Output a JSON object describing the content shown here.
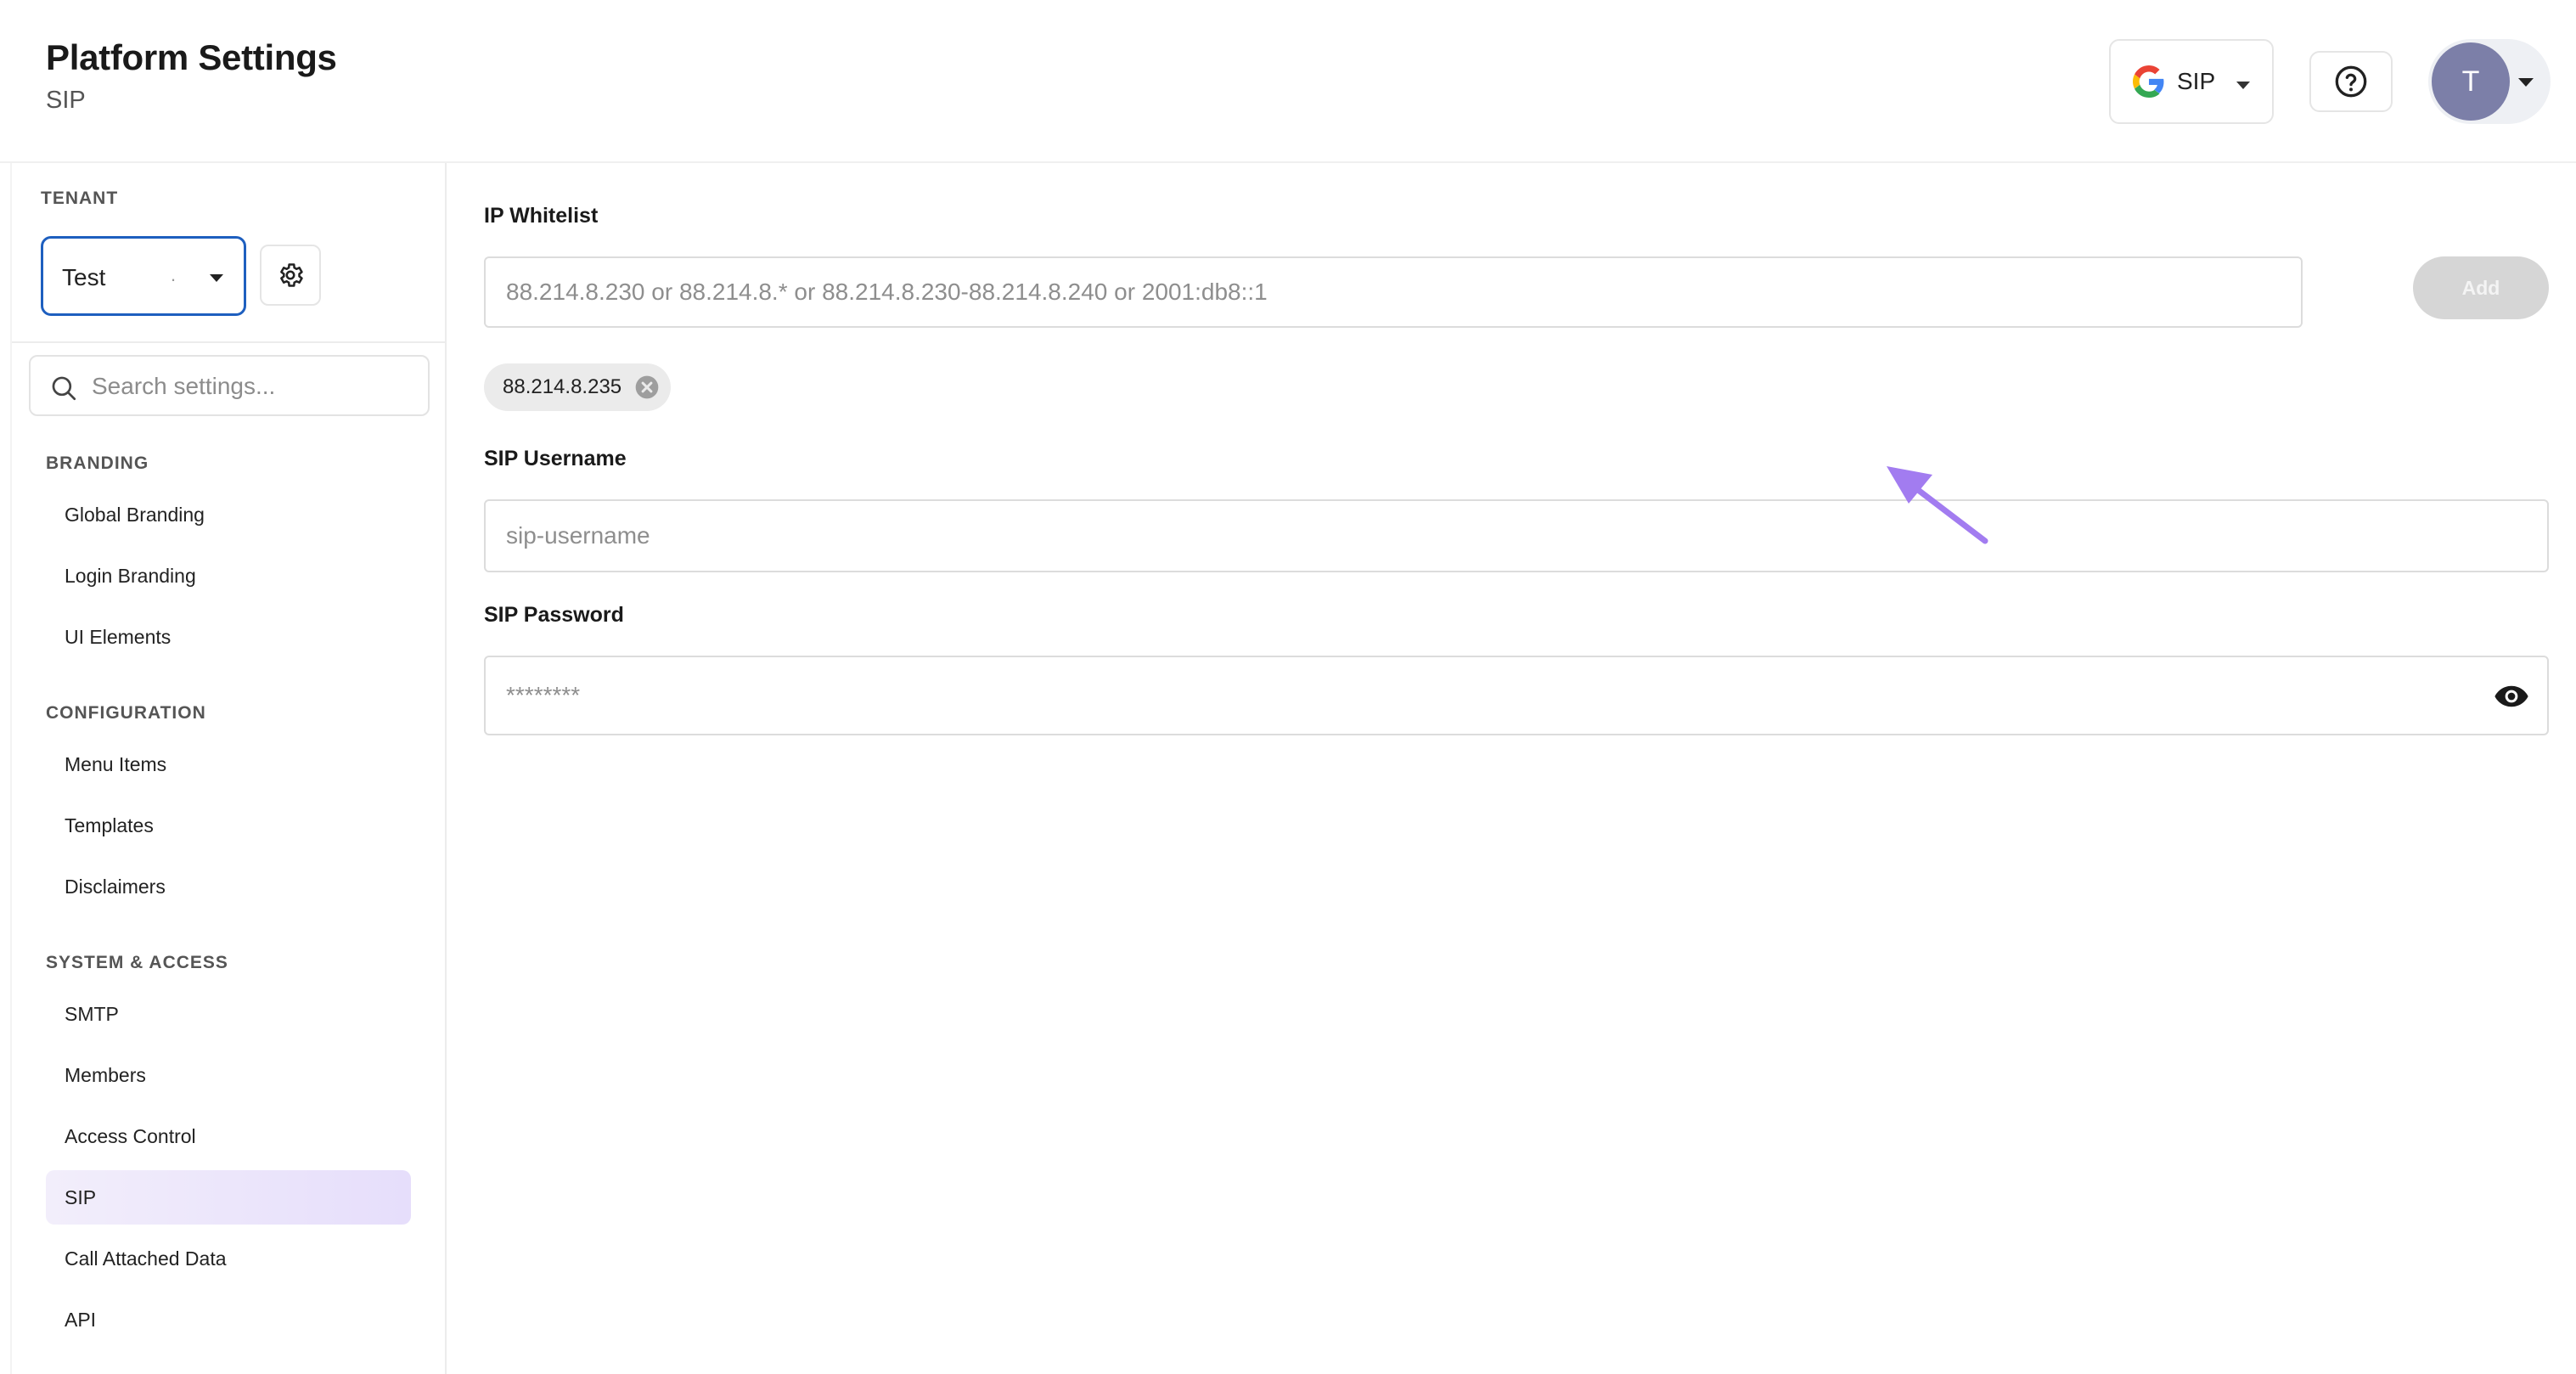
{
  "header": {
    "title": "Platform Settings",
    "subtitle": "SIP",
    "sip_selector": {
      "label": "SIP",
      "icon": "google-g-icon"
    },
    "help_icon": "help-circle-icon",
    "avatar": {
      "initial": "T"
    }
  },
  "sidebar": {
    "tenant_label": "TENANT",
    "tenant_value": "Test",
    "tenant_dot": ".",
    "search_placeholder": "Search settings...",
    "sections": [
      {
        "label": "BRANDING",
        "items": [
          "Global Branding",
          "Login Branding",
          "UI Elements"
        ]
      },
      {
        "label": "CONFIGURATION",
        "items": [
          "Menu Items",
          "Templates",
          "Disclaimers"
        ]
      },
      {
        "label": "SYSTEM & ACCESS",
        "items": [
          "SMTP",
          "Members",
          "Access Control",
          "SIP",
          "Call Attached Data",
          "API"
        ]
      }
    ],
    "active_item": "SIP"
  },
  "main": {
    "ip_whitelist": {
      "label": "IP Whitelist",
      "placeholder": "88.214.8.230 or 88.214.8.* or 88.214.8.230-88.214.8.240 or 2001:db8::1",
      "value": "",
      "add_label": "Add",
      "entries": [
        "88.214.8.235"
      ]
    },
    "sip_username": {
      "label": "SIP Username",
      "placeholder": "sip-username",
      "value": ""
    },
    "sip_password": {
      "label": "SIP Password",
      "placeholder": "********",
      "value": ""
    }
  },
  "colors": {
    "accent_blue": "#1e5fbf",
    "active_nav_bg": "#e6defb",
    "avatar_bg": "#7c7fa8",
    "annotation_arrow": "#a27cf0"
  }
}
